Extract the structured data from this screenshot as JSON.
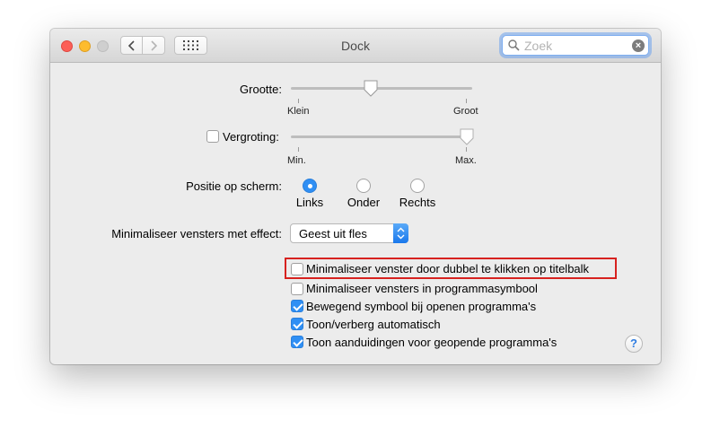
{
  "window": {
    "title": "Dock"
  },
  "search": {
    "placeholder": "Zoek"
  },
  "size": {
    "label": "Grootte:",
    "min_label": "Klein",
    "max_label": "Groot",
    "value": 0.44
  },
  "magnification": {
    "label": "Vergroting:",
    "enabled": false,
    "min_label": "Min.",
    "max_label": "Max.",
    "value": 0.97
  },
  "position": {
    "label": "Positie op scherm:",
    "options": [
      "Links",
      "Onder",
      "Rechts"
    ],
    "selected": "Links"
  },
  "minimize_effect": {
    "label": "Minimaliseer vensters met effect:",
    "value": "Geest uit fles"
  },
  "options": [
    {
      "label": "Minimaliseer venster door dubbel te klikken op titelbalk",
      "checked": false
    },
    {
      "label": "Minimaliseer vensters in programmasymbool",
      "checked": false
    },
    {
      "label": "Bewegend symbool bij openen programma's",
      "checked": true
    },
    {
      "label": "Toon/verberg automatisch",
      "checked": true
    },
    {
      "label": "Toon aanduidingen voor geopende programma's",
      "checked": true
    }
  ],
  "help": {
    "label": "?"
  },
  "colors": {
    "accent": "#2f8ff4",
    "highlight_border": "#d7221f"
  },
  "icons": [
    "back-icon",
    "forward-icon",
    "show-all-grid-icon",
    "search-icon",
    "clear-search-icon",
    "help-icon"
  ]
}
